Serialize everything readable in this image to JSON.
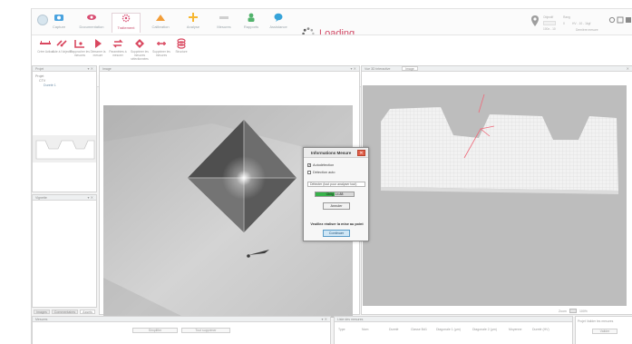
{
  "ribbon": {
    "tabs": [
      {
        "label": "Capture",
        "icon": "camera-icon",
        "color": "#4aa3df"
      },
      {
        "label": "Documentation",
        "icon": "eye-icon",
        "color": "#d84d72"
      },
      {
        "label": "Traitement",
        "icon": "gear-icon",
        "color": "#d84d72",
        "active": true
      },
      {
        "label": "Calibration",
        "icon": "calibration-icon",
        "color": "#f29d38"
      },
      {
        "label": "Analyse",
        "icon": "crosshair-icon",
        "color": "#f7b731"
      },
      {
        "label": "Mesures",
        "icon": "ruler-icon",
        "color": "#c2c2c2"
      },
      {
        "label": "Rapports",
        "icon": "user-icon",
        "color": "#52b36c"
      },
      {
        "label": "Assistance",
        "icon": "chat-icon",
        "color": "#36a3d9"
      }
    ],
    "tools": [
      {
        "label": "Créer Action",
        "icon": "ruler-red-icon"
      },
      {
        "label": "Aide à l'objectif",
        "icon": "link-icon"
      },
      {
        "label": "Rapprocher les mesures",
        "icon": "measure-icon"
      },
      {
        "label": "Démarrer la mesure",
        "icon": "play-icon"
      },
      {
        "label": "Paramètres à mesurer",
        "icon": "loop-icon"
      },
      {
        "label": "Supprimer les mesures sélectionnées",
        "icon": "target-icon"
      },
      {
        "label": "Supprimer les mesures",
        "icon": "delete-icon"
      },
      {
        "label": "Structure",
        "icon": "stack-icon"
      }
    ],
    "group_label": "Mesures",
    "loading_text": "Loading"
  },
  "top_right": {
    "label1": "Objectif",
    "value1": "100x - 10",
    "label2": "Rang",
    "fields": [
      "0",
      "HV - 10 - 1kgf"
    ],
    "extra": "Dernière mesure"
  },
  "left_panel": {
    "title": "Projet",
    "tree_root": "Projet",
    "tree_item": "CTV",
    "tree_child": "Dureté 1"
  },
  "left_panel2": {
    "title": "Vignette"
  },
  "bottom_tabs": [
    "Images",
    "Commentaires",
    "Assets"
  ],
  "center_panel": {
    "title": "Image"
  },
  "right_panel": {
    "title": "Vue 3D interactive",
    "tab": "Image"
  },
  "dialog": {
    "title": "Informations Mesure",
    "check1": "Autodétection",
    "check2": "Détection auto",
    "select_value": "Détecter (tout pour analyser tout)",
    "progress": 0.5,
    "progress_text": "Oblig. 14.88",
    "cancel": "Annuler",
    "message": "Veuillez réaliser la mise au point",
    "continue": "Continuer"
  },
  "bottom_left": {
    "title": "Mesures",
    "btn1": "Simplifier",
    "btn2": "Tout supprimer"
  },
  "bottom_right": {
    "title": "Liste des mesures",
    "columns": [
      "Type",
      "Nom",
      "Dureté",
      "Classe Bd1",
      "Diagonale 1 (µm)",
      "Diagonale 2 (µm)",
      "Moyenne",
      "Dureté (HV)"
    ]
  },
  "side_dock": {
    "label": "Projet Valider les mesures",
    "btn": "Valider"
  },
  "zoom": {
    "label": "Zoom",
    "value": "100%"
  }
}
